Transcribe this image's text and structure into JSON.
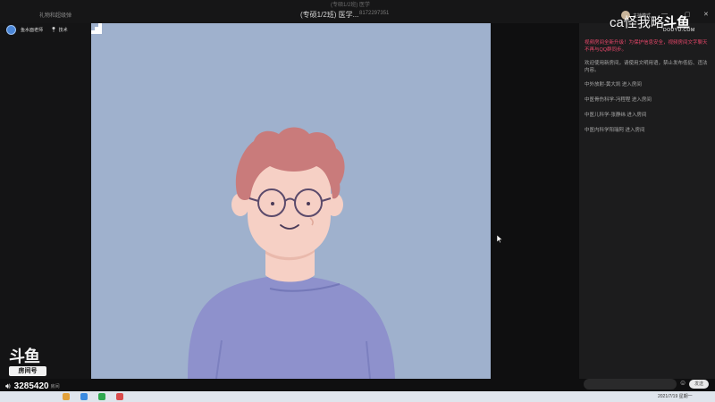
{
  "window": {
    "app_name": "礼物和超级弹",
    "title": "(专硕1/2班) 医学...",
    "room_id": "8172297351",
    "overlay_text": "(专硕1/2班) 医学"
  },
  "streamer": {
    "name": "鱼水面老师",
    "setting_label": "技术"
  },
  "platform_logo": {
    "glyph": "斗鱼",
    "subtitle": "房间号",
    "room_number": "3285420",
    "room_tag": "房间"
  },
  "watermark": {
    "text": "ca怪我略",
    "logo": "斗鱼",
    "domain": "DOUYU.COM"
  },
  "chat": {
    "host_mode": "主持模式",
    "notice": "视频房间全新升级！为保护信息安全，视频房间文字聊天不再与QQ群同步。",
    "welcome": "欢迎使用新房间，请使用文明用语，禁止发布低俗、违法内容。",
    "messages": [
      "中外放射-黄大凯 进入房间",
      "中医骨伤科学-冯程程 进入房间",
      "中医儿科学-张静纬 进入房间",
      "中医内科学阳瑞阿 进入房间"
    ],
    "input_placeholder": "",
    "send_label": "发送"
  },
  "taskbar": {
    "clock": "2021/7/19 星期一"
  },
  "icons": {
    "volume": "speaker-icon",
    "pin": "pin-icon",
    "emoji": "emoji-icon",
    "close": "close-icon",
    "minimize": "minimize-icon",
    "maximize": "maximize-icon"
  },
  "colors": {
    "stage_background": "#9fb1cd",
    "shirt": "#8e91cc",
    "hair": "#c97b7b",
    "skin": "#f6d0c5",
    "notice": "#e8476a"
  }
}
